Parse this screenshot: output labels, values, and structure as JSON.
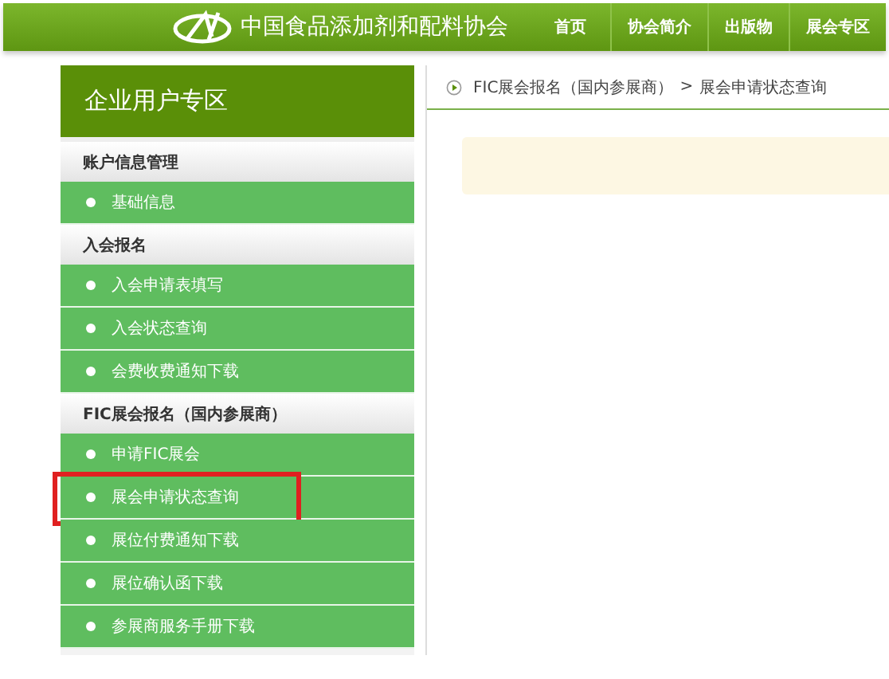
{
  "header": {
    "site_name": "中国食品添加剂和配料协会",
    "nav": [
      {
        "label": "首页"
      },
      {
        "label": "协会简介"
      },
      {
        "label": "出版物"
      },
      {
        "label": "展会专区"
      }
    ]
  },
  "sidebar": {
    "title": "企业用户专区",
    "groups": [
      {
        "label": "账户信息管理",
        "items": [
          {
            "label": "基础信息",
            "highlighted": false
          }
        ]
      },
      {
        "label": "入会报名",
        "items": [
          {
            "label": "入会申请表填写",
            "highlighted": false
          },
          {
            "label": "入会状态查询",
            "highlighted": false
          },
          {
            "label": "会费收费通知下载",
            "highlighted": false
          }
        ]
      },
      {
        "label": "FIC展会报名（国内参展商）",
        "items": [
          {
            "label": "申请FIC展会",
            "highlighted": false
          },
          {
            "label": "展会申请状态查询",
            "highlighted": true
          },
          {
            "label": "展位付费通知下载",
            "highlighted": false
          },
          {
            "label": "展位确认函下载",
            "highlighted": false
          },
          {
            "label": "参展商服务手册下载",
            "highlighted": false
          }
        ]
      }
    ]
  },
  "breadcrumb": {
    "parent": "FIC展会报名（国内参展商）",
    "separator": ">",
    "current": "展会申请状态查询"
  }
}
